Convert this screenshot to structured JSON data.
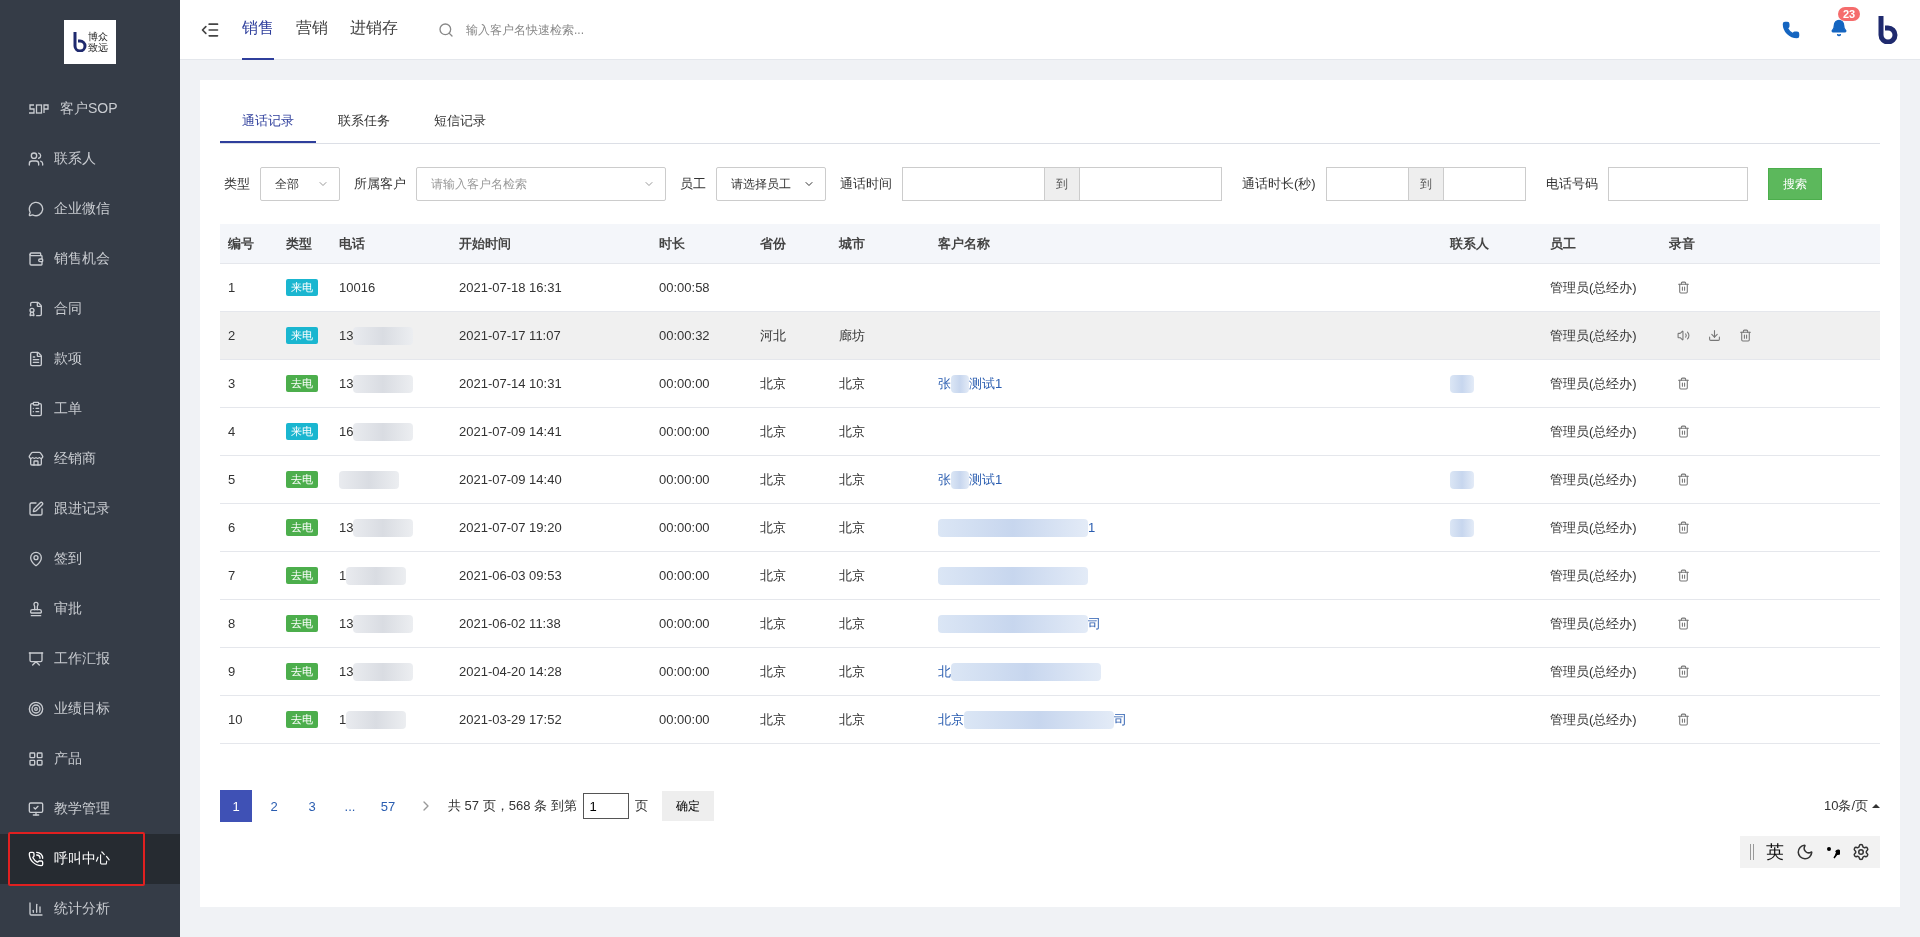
{
  "sidebar": {
    "logo_lines": [
      "博众",
      "致远"
    ],
    "items": [
      {
        "label": "客户SOP",
        "selected": false
      },
      {
        "label": "联系人",
        "selected": false
      },
      {
        "label": "企业微信",
        "selected": false
      },
      {
        "label": "销售机会",
        "selected": false
      },
      {
        "label": "合同",
        "selected": false
      },
      {
        "label": "款项",
        "selected": false
      },
      {
        "label": "工单",
        "selected": false
      },
      {
        "label": "经销商",
        "selected": false
      },
      {
        "label": "跟进记录",
        "selected": false
      },
      {
        "label": "签到",
        "selected": false
      },
      {
        "label": "审批",
        "selected": false
      },
      {
        "label": "工作汇报",
        "selected": false
      },
      {
        "label": "业绩目标",
        "selected": false
      },
      {
        "label": "产品",
        "selected": false
      },
      {
        "label": "教学管理",
        "selected": false
      },
      {
        "label": "呼叫中心",
        "selected": true
      },
      {
        "label": "统计分析",
        "selected": false
      }
    ]
  },
  "topbar": {
    "tabs": [
      {
        "label": "销售",
        "selected": true
      },
      {
        "label": "营销",
        "selected": false
      },
      {
        "label": "进销存",
        "selected": false
      }
    ],
    "search": {
      "placeholder": "输入客户名快速检索..."
    },
    "notifications": "23"
  },
  "tabs": [
    {
      "label": "通话记录",
      "selected": true
    },
    {
      "label": "联系任务",
      "selected": false
    },
    {
      "label": "短信记录",
      "selected": false
    }
  ],
  "filters": {
    "type_label": "类型",
    "type_value": "全部",
    "customer_label": "所属客户",
    "customer_placeholder": "请输入客户名检索",
    "staff_label": "员工",
    "staff_value": "请选择员工",
    "time_label": "通话时间",
    "to_1": "到",
    "duration_label": "通话时长(秒)",
    "to_2": "到",
    "phone_label": "电话号码",
    "search_button": "搜索"
  },
  "table": {
    "columns": [
      "编号",
      "类型",
      "电话",
      "开始时间",
      "时长",
      "省份",
      "城市",
      "客户名称",
      "联系人",
      "员工",
      "录音"
    ],
    "rows": [
      {
        "no": "1",
        "type": "来电",
        "kind": "incoming",
        "phone": "10016",
        "phone_blur": false,
        "start": "2021-07-18 16:31",
        "duration": "00:00:58",
        "province": "",
        "city": "",
        "customer_before": "",
        "customer_after": "",
        "customer_blur": false,
        "contact_blur": false,
        "staff": "管理员(总经办)",
        "playable": false,
        "selected": false
      },
      {
        "no": "2",
        "type": "来电",
        "kind": "incoming",
        "phone": "13",
        "phone_blur": true,
        "start": "2021-07-17 11:07",
        "duration": "00:00:32",
        "province": "河北",
        "city": "廊坊",
        "customer_before": "",
        "customer_after": "",
        "customer_blur": false,
        "contact_blur": false,
        "staff": "管理员(总经办)",
        "playable": true,
        "selected": true
      },
      {
        "no": "3",
        "type": "去电",
        "kind": "outgoing",
        "phone": "13",
        "phone_blur": true,
        "start": "2021-07-14 10:31",
        "duration": "00:00:00",
        "province": "北京",
        "city": "北京",
        "customer_before": "张",
        "customer_after": "测试1",
        "customer_blur": true,
        "contact_blur": true,
        "staff": "管理员(总经办)",
        "playable": false,
        "selected": false
      },
      {
        "no": "4",
        "type": "来电",
        "kind": "incoming",
        "phone": "16",
        "phone_blur": true,
        "start": "2021-07-09 14:41",
        "duration": "00:00:00",
        "province": "北京",
        "city": "北京",
        "customer_before": "",
        "customer_after": "",
        "customer_blur": false,
        "contact_blur": false,
        "staff": "管理员(总经办)",
        "playable": false,
        "selected": false
      },
      {
        "no": "5",
        "type": "去电",
        "kind": "outgoing",
        "phone": "",
        "phone_blur": true,
        "start": "2021-07-09 14:40",
        "duration": "00:00:00",
        "province": "北京",
        "city": "北京",
        "customer_before": "张",
        "customer_after": "测试1",
        "customer_blur": true,
        "contact_blur": true,
        "staff": "管理员(总经办)",
        "playable": false,
        "selected": false
      },
      {
        "no": "6",
        "type": "去电",
        "kind": "outgoing",
        "phone": "13",
        "phone_blur": true,
        "start": "2021-07-07 19:20",
        "duration": "00:00:00",
        "province": "北京",
        "city": "北京",
        "customer_before": "",
        "customer_after": "1",
        "customer_blur": true,
        "contact_blur": true,
        "staff": "管理员(总经办)",
        "playable": false,
        "selected": false
      },
      {
        "no": "7",
        "type": "去电",
        "kind": "outgoing",
        "phone": "1",
        "phone_blur": true,
        "start": "2021-06-03 09:53",
        "duration": "00:00:00",
        "province": "北京",
        "city": "北京",
        "customer_before": "",
        "customer_after": "",
        "customer_blur": true,
        "contact_blur": false,
        "staff": "管理员(总经办)",
        "playable": false,
        "selected": false
      },
      {
        "no": "8",
        "type": "去电",
        "kind": "outgoing",
        "phone": "13",
        "phone_blur": true,
        "start": "2021-06-02 11:38",
        "duration": "00:00:00",
        "province": "北京",
        "city": "北京",
        "customer_before": "",
        "customer_after": "司",
        "customer_blur": true,
        "contact_blur": false,
        "staff": "管理员(总经办)",
        "playable": false,
        "selected": false
      },
      {
        "no": "9",
        "type": "去电",
        "kind": "outgoing",
        "phone": "13",
        "phone_blur": true,
        "start": "2021-04-20 14:28",
        "duration": "00:00:00",
        "province": "北京",
        "city": "北京",
        "customer_before": "北",
        "customer_after": "",
        "customer_blur": true,
        "contact_blur": false,
        "staff": "管理员(总经办)",
        "playable": false,
        "selected": false
      },
      {
        "no": "10",
        "type": "去电",
        "kind": "outgoing",
        "phone": "1",
        "phone_blur": true,
        "start": "2021-03-29 17:52",
        "duration": "00:00:00",
        "province": "北京",
        "city": "北京",
        "customer_before": "北京",
        "customer_after": "司",
        "customer_blur": true,
        "contact_blur": false,
        "staff": "管理员(总经办)",
        "playable": false,
        "selected": false
      }
    ]
  },
  "pagination": {
    "pages": [
      {
        "label": "1",
        "selected": true
      },
      {
        "label": "2",
        "selected": false
      },
      {
        "label": "3",
        "selected": false
      },
      {
        "label": "...",
        "selected": false
      },
      {
        "label": "57",
        "selected": false
      }
    ],
    "summary": "共 57 页，568 条 到第",
    "jump_value": "1",
    "page_unit": "页",
    "confirm": "确定",
    "page_size": "10条/页"
  },
  "ime_toolbar": {
    "lang": "英"
  }
}
